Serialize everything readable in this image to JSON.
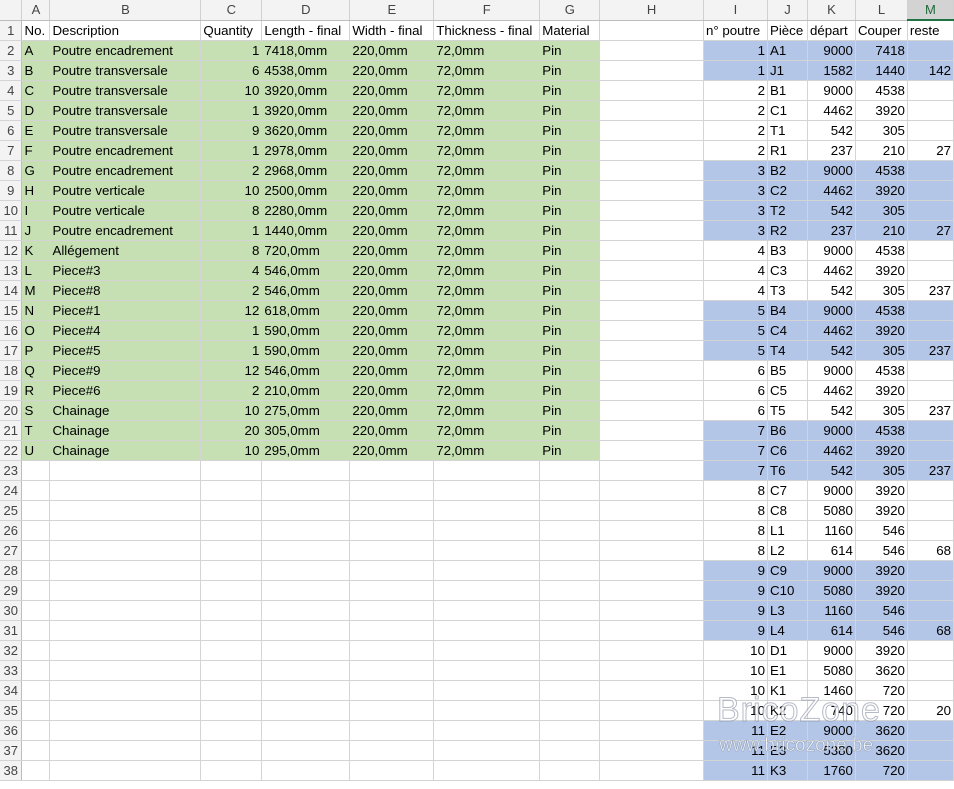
{
  "columns": [
    "A",
    "B",
    "C",
    "D",
    "E",
    "F",
    "G",
    "H",
    "I",
    "J",
    "K",
    "L",
    "M"
  ],
  "selected_column": "M",
  "rows": [
    [
      "No.",
      "Description",
      "Quantity",
      "Length - final",
      "Width - final",
      "Thickness - final",
      "Material",
      "",
      "n° poutre",
      "Pièce",
      "départ",
      "Couper",
      "reste"
    ],
    [
      "A",
      "Poutre encadrement",
      "1",
      "7418,0mm",
      "220,0mm",
      "72,0mm",
      "Pin",
      "",
      "1",
      "A1",
      "9000",
      "7418",
      ""
    ],
    [
      "B",
      "Poutre transversale",
      "6",
      "4538,0mm",
      "220,0mm",
      "72,0mm",
      "Pin",
      "",
      "1",
      "J1",
      "1582",
      "1440",
      "142"
    ],
    [
      "C",
      "Poutre transversale",
      "10",
      "3920,0mm",
      "220,0mm",
      "72,0mm",
      "Pin",
      "",
      "2",
      "B1",
      "9000",
      "4538",
      ""
    ],
    [
      "D",
      "Poutre transversale",
      "1",
      "3920,0mm",
      "220,0mm",
      "72,0mm",
      "Pin",
      "",
      "2",
      "C1",
      "4462",
      "3920",
      ""
    ],
    [
      "E",
      "Poutre transversale",
      "9",
      "3620,0mm",
      "220,0mm",
      "72,0mm",
      "Pin",
      "",
      "2",
      "T1",
      "542",
      "305",
      ""
    ],
    [
      "F",
      "Poutre encadrement",
      "1",
      "2978,0mm",
      "220,0mm",
      "72,0mm",
      "Pin",
      "",
      "2",
      "R1",
      "237",
      "210",
      "27"
    ],
    [
      "G",
      "Poutre encadrement",
      "2",
      "2968,0mm",
      "220,0mm",
      "72,0mm",
      "Pin",
      "",
      "3",
      "B2",
      "9000",
      "4538",
      ""
    ],
    [
      "H",
      "Poutre verticale",
      "10",
      "2500,0mm",
      "220,0mm",
      "72,0mm",
      "Pin",
      "",
      "3",
      "C2",
      "4462",
      "3920",
      ""
    ],
    [
      "I",
      "Poutre verticale",
      "8",
      "2280,0mm",
      "220,0mm",
      "72,0mm",
      "Pin",
      "",
      "3",
      "T2",
      "542",
      "305",
      ""
    ],
    [
      "J",
      "Poutre encadrement",
      "1",
      "1440,0mm",
      "220,0mm",
      "72,0mm",
      "Pin",
      "",
      "3",
      "R2",
      "237",
      "210",
      "27"
    ],
    [
      "K",
      "Allégement",
      "8",
      "720,0mm",
      "220,0mm",
      "72,0mm",
      "Pin",
      "",
      "4",
      "B3",
      "9000",
      "4538",
      ""
    ],
    [
      "L",
      "Piece#3",
      "4",
      "546,0mm",
      "220,0mm",
      "72,0mm",
      "Pin",
      "",
      "4",
      "C3",
      "4462",
      "3920",
      ""
    ],
    [
      "M",
      "Piece#8",
      "2",
      "546,0mm",
      "220,0mm",
      "72,0mm",
      "Pin",
      "",
      "4",
      "T3",
      "542",
      "305",
      "237"
    ],
    [
      "N",
      "Piece#1",
      "12",
      "618,0mm",
      "220,0mm",
      "72,0mm",
      "Pin",
      "",
      "5",
      "B4",
      "9000",
      "4538",
      ""
    ],
    [
      "O",
      "Piece#4",
      "1",
      "590,0mm",
      "220,0mm",
      "72,0mm",
      "Pin",
      "",
      "5",
      "C4",
      "4462",
      "3920",
      ""
    ],
    [
      "P",
      "Piece#5",
      "1",
      "590,0mm",
      "220,0mm",
      "72,0mm",
      "Pin",
      "",
      "5",
      "T4",
      "542",
      "305",
      "237"
    ],
    [
      "Q",
      "Piece#9",
      "12",
      "546,0mm",
      "220,0mm",
      "72,0mm",
      "Pin",
      "",
      "6",
      "B5",
      "9000",
      "4538",
      ""
    ],
    [
      "R",
      "Piece#6",
      "2",
      "210,0mm",
      "220,0mm",
      "72,0mm",
      "Pin",
      "",
      "6",
      "C5",
      "4462",
      "3920",
      ""
    ],
    [
      "S",
      "Chainage",
      "10",
      "275,0mm",
      "220,0mm",
      "72,0mm",
      "Pin",
      "",
      "6",
      "T5",
      "542",
      "305",
      "237"
    ],
    [
      "T",
      "Chainage",
      "20",
      "305,0mm",
      "220,0mm",
      "72,0mm",
      "Pin",
      "",
      "7",
      "B6",
      "9000",
      "4538",
      ""
    ],
    [
      "U",
      "Chainage",
      "10",
      "295,0mm",
      "220,0mm",
      "72,0mm",
      "Pin",
      "",
      "7",
      "C6",
      "4462",
      "3920",
      ""
    ],
    [
      "",
      "",
      "",
      "",
      "",
      "",
      "",
      "",
      "7",
      "T6",
      "542",
      "305",
      "237"
    ],
    [
      "",
      "",
      "",
      "",
      "",
      "",
      "",
      "",
      "8",
      "C7",
      "9000",
      "3920",
      ""
    ],
    [
      "",
      "",
      "",
      "",
      "",
      "",
      "",
      "",
      "8",
      "C8",
      "5080",
      "3920",
      ""
    ],
    [
      "",
      "",
      "",
      "",
      "",
      "",
      "",
      "",
      "8",
      "L1",
      "1160",
      "546",
      ""
    ],
    [
      "",
      "",
      "",
      "",
      "",
      "",
      "",
      "",
      "8",
      "L2",
      "614",
      "546",
      "68"
    ],
    [
      "",
      "",
      "",
      "",
      "",
      "",
      "",
      "",
      "9",
      "C9",
      "9000",
      "3920",
      ""
    ],
    [
      "",
      "",
      "",
      "",
      "",
      "",
      "",
      "",
      "9",
      "C10",
      "5080",
      "3920",
      ""
    ],
    [
      "",
      "",
      "",
      "",
      "",
      "",
      "",
      "",
      "9",
      "L3",
      "1160",
      "546",
      ""
    ],
    [
      "",
      "",
      "",
      "",
      "",
      "",
      "",
      "",
      "9",
      "L4",
      "614",
      "546",
      "68"
    ],
    [
      "",
      "",
      "",
      "",
      "",
      "",
      "",
      "",
      "10",
      "D1",
      "9000",
      "3920",
      ""
    ],
    [
      "",
      "",
      "",
      "",
      "",
      "",
      "",
      "",
      "10",
      "E1",
      "5080",
      "3620",
      ""
    ],
    [
      "",
      "",
      "",
      "",
      "",
      "",
      "",
      "",
      "10",
      "K1",
      "1460",
      "720",
      ""
    ],
    [
      "",
      "",
      "",
      "",
      "",
      "",
      "",
      "",
      "10",
      "K2",
      "740",
      "720",
      "20"
    ],
    [
      "",
      "",
      "",
      "",
      "",
      "",
      "",
      "",
      "11",
      "E2",
      "9000",
      "3620",
      ""
    ],
    [
      "",
      "",
      "",
      "",
      "",
      "",
      "",
      "",
      "11",
      "E3",
      "5380",
      "3620",
      ""
    ],
    [
      "",
      "",
      "",
      "",
      "",
      "",
      "",
      "",
      "11",
      "K3",
      "1760",
      "720",
      ""
    ]
  ],
  "blue_groups": [
    1,
    3,
    5,
    7,
    9,
    11
  ],
  "watermark": {
    "logo": "BricoZone",
    "url": "www.bricozone.be"
  },
  "colors": {
    "green_fill": "#c6e0b4",
    "blue_fill": "#b4c6e7",
    "header_bg": "#f3f3f3",
    "accent": "#217346"
  }
}
